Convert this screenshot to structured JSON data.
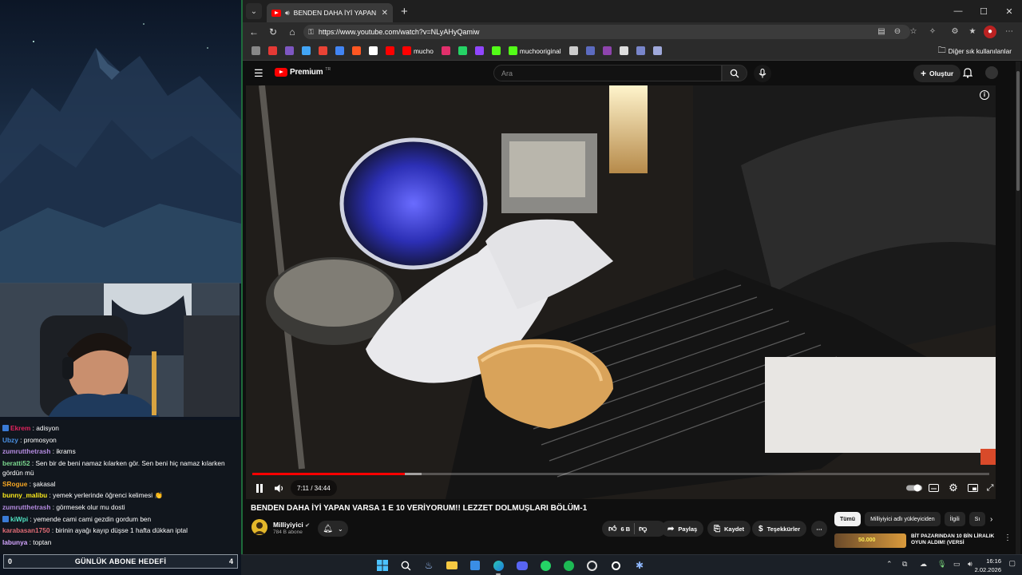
{
  "overlay": {
    "chat": [
      {
        "user": "Ekrem",
        "text": "adisyon",
        "color": "#e0245e",
        "badge": true
      },
      {
        "user": "Ubzy",
        "text": "promosyon",
        "color": "#4a90e2",
        "badge": false
      },
      {
        "user": "zumrutthetrash",
        "text": "ikrams",
        "color": "#b48be0",
        "badge": false
      },
      {
        "user": "beratti52",
        "text": "Sen bir de beni namaz kılarken gör. Sen beni hiç namaz kılarken gördün mü",
        "color": "#7bd88f",
        "badge": false
      },
      {
        "user": "SRogue",
        "text": "şakasal",
        "color": "#f5a623",
        "badge": false
      },
      {
        "user": "bunny_malibu",
        "text": "yemek yerlerinde öğrenci kelimesi 👏",
        "color": "#f8e71c",
        "badge": false
      },
      {
        "user": "zumrutthetrash",
        "text": "görmesek olur mu dosti",
        "color": "#b48be0",
        "badge": false
      },
      {
        "user": "kiWpi",
        "text": "yemende cami cami gezdin gordum ben",
        "color": "#50e3c2",
        "badge": true
      },
      {
        "user": "karabasan1750",
        "text": "birinin ayağı kayıp düşse 1 hafta dükkan iptal",
        "color": "#e06c75",
        "badge": false
      },
      {
        "user": "labunya",
        "text": "toptan",
        "color": "#d4a5ff",
        "badge": false
      }
    ],
    "goal": {
      "current": "0",
      "label": "GÜNLÜK ABONE HEDEFİ",
      "target": "4"
    }
  },
  "browser": {
    "tab_title": "BENDEN DAHA İYİ YAPAN VA",
    "url": "https://www.youtube.com/watch?v=NLyAHyQamiw",
    "bookmarks": [
      {
        "label": "",
        "color": "#888888"
      },
      {
        "label": "",
        "color": "#e53935"
      },
      {
        "label": "",
        "color": "#7e57c2"
      },
      {
        "label": "",
        "color": "#42a5f5"
      },
      {
        "label": "",
        "color": "#ea4335"
      },
      {
        "label": "",
        "color": "#4285f4"
      },
      {
        "label": "",
        "color": "#ff5722"
      },
      {
        "label": "",
        "color": "#ffffff"
      },
      {
        "label": "",
        "color": "#ff0000"
      },
      {
        "label": "mucho",
        "color": "#ff0000"
      },
      {
        "label": "",
        "color": "#e1306c"
      },
      {
        "label": "",
        "color": "#25d366"
      },
      {
        "label": "",
        "color": "#9146ff"
      },
      {
        "label": "",
        "color": "#53fc18"
      },
      {
        "label": "muchooriginal",
        "color": "#53fc18"
      },
      {
        "label": "",
        "color": "#cccccc"
      },
      {
        "label": "",
        "color": "#5c6bc0"
      },
      {
        "label": "",
        "color": "#8e44ad"
      },
      {
        "label": "",
        "color": "#dddddd"
      },
      {
        "label": "",
        "color": "#7986cb"
      },
      {
        "label": "",
        "color": "#9fa8da"
      }
    ],
    "bookmarks_other": "Diğer sık kullanılanlar"
  },
  "youtube": {
    "logo_text": "Premium",
    "logo_sup": "TR",
    "search_placeholder": "Ara",
    "create_label": "Oluştur",
    "player": {
      "time": "7:11 / 34:44",
      "progress_played": 0.207,
      "progress_loaded": 0.23
    },
    "video_title": "BENDEN DAHA İYİ YAPAN VARSA 1 E 10 VERİYORUM!! LEZZET DOLMUŞLARI BÖLÜM-1",
    "channel": {
      "name": "Milliyiyici",
      "subs": "784 B abone"
    },
    "actions": {
      "likes": "6 B",
      "share": "Paylaş",
      "save": "Kaydet",
      "thanks": "Teşekkürler"
    },
    "chips": [
      "Tümü",
      "Milliyiyici adlı yükleyiciden",
      "İlgili",
      "Sı"
    ],
    "recommendation": {
      "thumb_text": "50.000",
      "title": "BİT PAZARINDAN 10 BİN LİRALIK OYUN ALDIM! (VERSİ"
    }
  },
  "taskbar": {
    "time": "16:16",
    "date": "2.02.2026"
  }
}
